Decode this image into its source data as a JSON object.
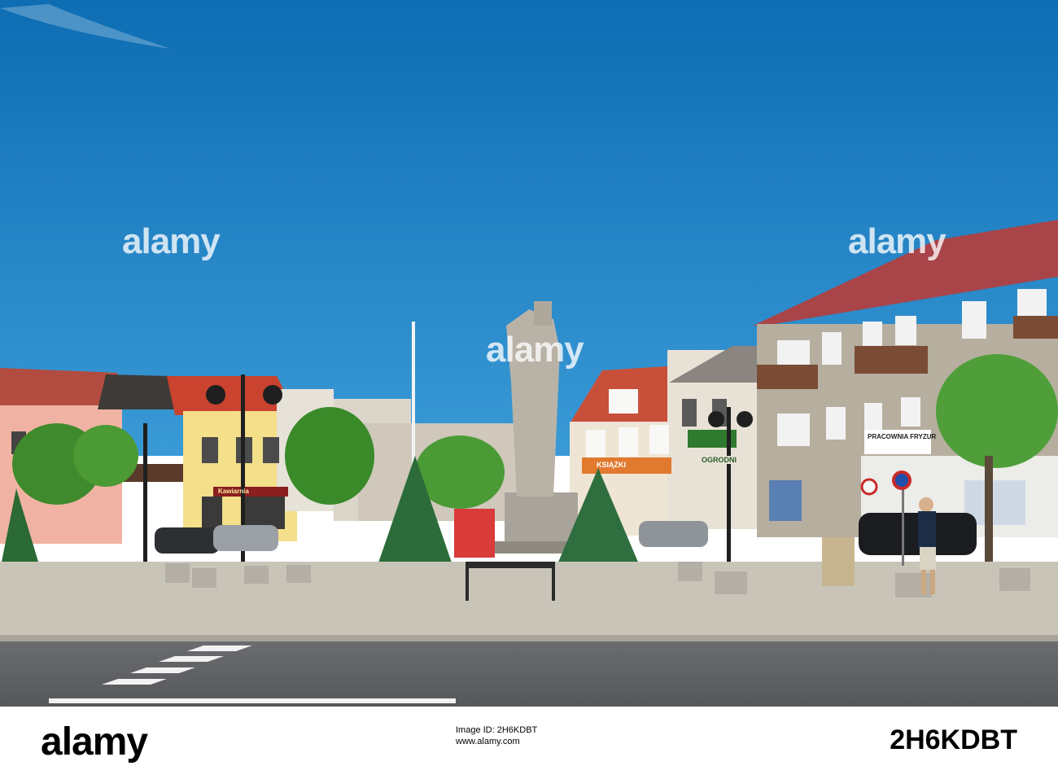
{
  "watermark": {
    "brand": "alamy",
    "image_id": "2H6KDBT"
  },
  "footer": {
    "brand": "alamy",
    "image_id_label": "Image ID: 2H6KDBT",
    "site": "www.alamy.com",
    "image_id": "2H6KDBT"
  },
  "signs": {
    "bookshop": "KSIĄŻKI",
    "garden": "OGRODNI",
    "barber": "PRACOWNIA FRYZUR",
    "store_top": "Kawiarnia"
  },
  "colors": {
    "sky": "#1a7fc3",
    "sky_top": "#0f6fb4",
    "roof_red": "#b53a2f",
    "road": "#5f6164",
    "pavement": "#c9c4b8"
  }
}
